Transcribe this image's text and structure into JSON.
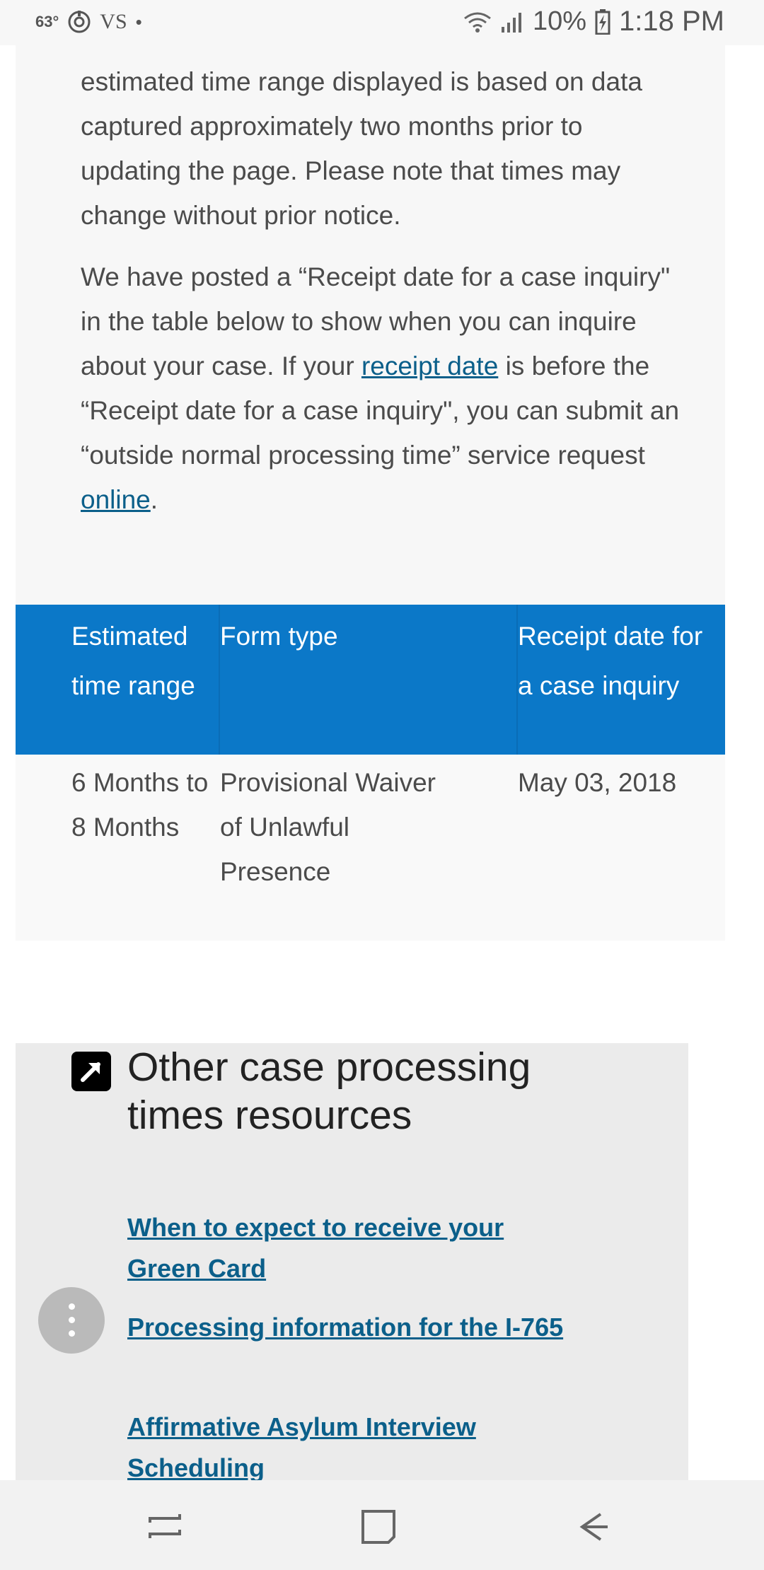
{
  "status_bar": {
    "temperature": "63°",
    "carrier": "VS",
    "dot": "•",
    "battery_percent": "10%",
    "time": "1:18 PM",
    "icons": [
      "sync-icon",
      "wifi-icon",
      "signal-icon",
      "battery-charging-icon"
    ]
  },
  "intro": {
    "paragraph1": "estimated time range displayed is based on data captured approximately two months prior to updating the page. Please note that times may change without prior notice.",
    "paragraph2_part1": "We have posted a “Receipt date for a case inquiry\" in the table below to show when you can inquire about your case. If your ",
    "receipt_date_link": "receipt date",
    "paragraph2_part2": " is before the “Receipt date for a case inquiry\", you can submit an “outside normal processing time” service request ",
    "online_link": "online",
    "paragraph2_end": "."
  },
  "table": {
    "headers": [
      "Estimated time range",
      "Form type",
      "Receipt date for a case inquiry"
    ],
    "rows": [
      {
        "time_range": "6 Months to 8 Months",
        "form_type": "Provisional Waiver of Unlawful Presence",
        "receipt_date": "May 03, 2018"
      }
    ]
  },
  "resources": {
    "title": "Other case processing times resources",
    "links": [
      "When to expect to receive your Green Card",
      "Processing information for the I-765",
      "Affirmative Asylum Interview Scheduling"
    ]
  },
  "colors": {
    "table_header": "#0b78c8",
    "link": "#0b5f8a",
    "panel_bg": "#f7f7f7",
    "resources_bg": "#ebebeb"
  },
  "nav_bar": {
    "icons": [
      "recent-apps-icon",
      "home-icon",
      "back-icon"
    ]
  }
}
